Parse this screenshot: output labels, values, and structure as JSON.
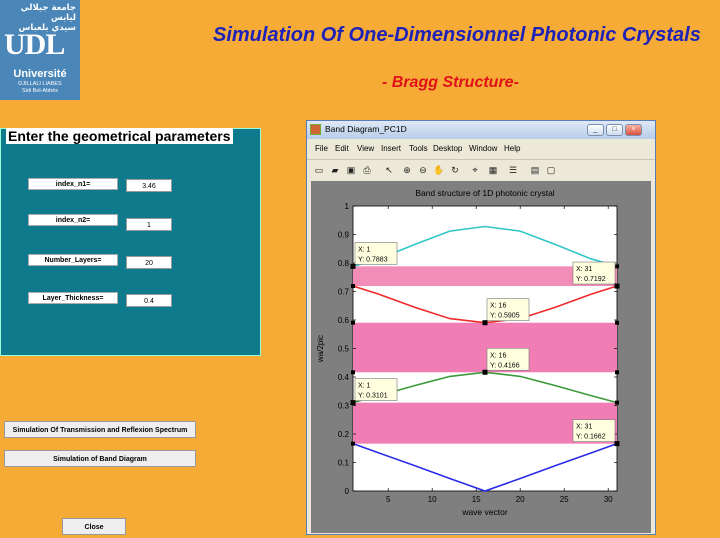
{
  "logo": {
    "arabic": "جامعة جيلالي ليابس\nسيدي بلعباس",
    "udl": "UDL",
    "univ": "Université",
    "city": "DJILLALI LIABES\nSidi Bel-Abbès"
  },
  "header": {
    "title": "Simulation Of One-Dimensionnel Photonic Crystals",
    "subtitle": "- Bragg Structure-"
  },
  "params": {
    "panel_title": "Enter the geometrical parameters",
    "fields": [
      {
        "label": "index_n1=",
        "value": "3.46"
      },
      {
        "label": "index_n2=",
        "value": "1"
      },
      {
        "label": "Number_Layers=",
        "value": "20"
      },
      {
        "label": "Layer_Thickness=",
        "value": "0.4"
      }
    ]
  },
  "buttons": {
    "transmission": "Simulation Of Transmission and Reflexion Spectrum",
    "band": "Simulation of Band Diagram",
    "close": "Close"
  },
  "window": {
    "title": "Band Diagram_PC1D",
    "menu": [
      "File",
      "Edit",
      "View",
      "Insert",
      "Tools",
      "Desktop",
      "Window",
      "Help"
    ],
    "toolbar_icons": [
      "new-file-icon",
      "open-file-icon",
      "save-icon",
      "print-icon",
      "select-arrow-icon",
      "zoom-in-icon",
      "zoom-out-icon",
      "pan-icon",
      "rotate-icon",
      "data-cursor-icon",
      "colorbar-icon",
      "legend-icon",
      "hide-plot-tools-icon"
    ]
  },
  "colors": {
    "background": "#F5AB35",
    "panel": "#0E7A8C",
    "title": "#1E22B8",
    "subtitle": "#E0101A",
    "band_gap": "#F07EB5",
    "band_gap_upper": "#F28DB8"
  },
  "chart_data": {
    "type": "line",
    "title": "Band structure of 1D photonic crystal",
    "xlabel": "wave vector",
    "ylabel": "wa/2pic",
    "xlim": [
      1,
      31
    ],
    "ylim": [
      0,
      1
    ],
    "xticks": [
      "5",
      "10",
      "15",
      "20",
      "25",
      "30"
    ],
    "yticks": [
      "0",
      "0.1",
      "0.2",
      "0.3",
      "0.4",
      "0.5",
      "0.6",
      "0.7",
      "0.8",
      "0.9",
      "1"
    ],
    "series": [
      {
        "color": "#2B2BE8",
        "x": [
          1,
          4,
          8,
          12,
          16,
          20,
          24,
          28,
          31
        ],
        "values": [
          0.1662,
          0.133,
          0.089,
          0.044,
          0.0,
          0.044,
          0.089,
          0.133,
          0.1662
        ]
      },
      {
        "color": "#3C9A3C",
        "x": [
          1,
          4,
          8,
          12,
          16,
          20,
          24,
          28,
          31
        ],
        "values": [
          0.3101,
          0.335,
          0.37,
          0.402,
          0.4166,
          0.402,
          0.37,
          0.335,
          0.3101
        ]
      },
      {
        "color": "#EE2A2A",
        "x": [
          1,
          4,
          8,
          12,
          16,
          20,
          24,
          28,
          31
        ],
        "values": [
          0.7192,
          0.69,
          0.645,
          0.605,
          0.5905,
          0.605,
          0.645,
          0.69,
          0.7192
        ]
      },
      {
        "color": "#33C6C6",
        "x": [
          1,
          4,
          8,
          12,
          16,
          20,
          24,
          28,
          31
        ],
        "values": [
          0.7883,
          0.815,
          0.865,
          0.912,
          0.928,
          0.912,
          0.865,
          0.815,
          0.7883
        ]
      }
    ],
    "gaps": [
      [
        0.1662,
        0.3101
      ],
      [
        0.4166,
        0.5905
      ],
      [
        0.7192,
        0.7883
      ]
    ],
    "datatips": [
      {
        "label_x": "X: 1",
        "label_y": "Y: 0.7883",
        "x": 1,
        "y": 0.7883,
        "anchor": "right"
      },
      {
        "label_x": "X: 16",
        "label_y": "Y: 0.5905",
        "x": 16,
        "y": 0.5905,
        "anchor": "right"
      },
      {
        "label_x": "X: 31",
        "label_y": "Y: 0.7192",
        "x": 31,
        "y": 0.7192,
        "anchor": "left"
      },
      {
        "label_x": "X: 1",
        "label_y": "Y: 0.3101",
        "x": 1,
        "y": 0.3101,
        "anchor": "right"
      },
      {
        "label_x": "X: 16",
        "label_y": "Y: 0.4166",
        "x": 16,
        "y": 0.4166,
        "anchor": "right"
      },
      {
        "label_x": "X: 31",
        "label_y": "Y: 0.1662",
        "x": 31,
        "y": 0.1662,
        "anchor": "left"
      }
    ]
  }
}
